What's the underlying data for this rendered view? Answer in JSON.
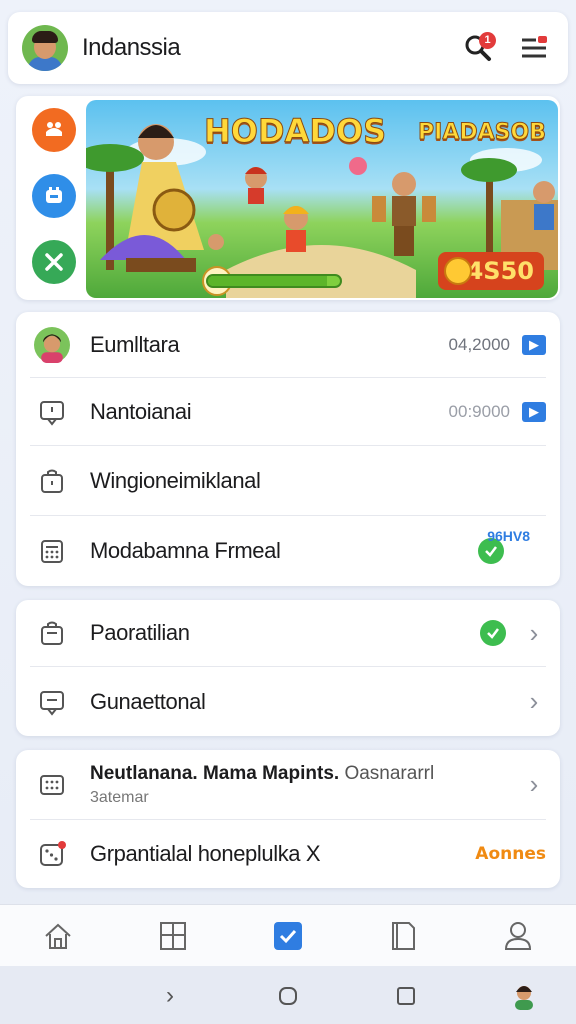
{
  "header": {
    "title": "Indanssia",
    "notification_count": "1"
  },
  "banner": {
    "title_left": "HODADOS",
    "title_right": "PIADASOB",
    "score": "4S50",
    "progress": 0.9
  },
  "list1": {
    "rows": [
      {
        "label": "Eumlltara",
        "value": "04,2000"
      },
      {
        "label": "Nantoianai",
        "value": "00:9000"
      },
      {
        "label": "Wingioneimiklanal"
      },
      {
        "label": "Modabamna Frmeal",
        "tag": "96HV8"
      }
    ]
  },
  "list2": {
    "rows": [
      {
        "label": "Paoratilian"
      },
      {
        "label": "Gunaettonal"
      }
    ]
  },
  "list3": {
    "rows": [
      {
        "label_bold": "Neutlanana. Mama Mapints.",
        "label_rest": " Oasnararrl",
        "sub": "3atemar"
      },
      {
        "label": "Grpantialal honeplulka X",
        "tag": "Aonnes"
      }
    ]
  },
  "colors": {
    "accent": "#2f7de1",
    "success": "#3dbd4f",
    "orange": "#f08a12",
    "badge": "#e23b3b"
  },
  "icons": {
    "header": [
      "avatar",
      "search-icon",
      "menu-settings-icon"
    ],
    "side": [
      "orange-chat-icon",
      "blue-app-icon",
      "green-tools-icon"
    ],
    "nav": [
      "home-icon",
      "grid-icon",
      "check-icon",
      "document-icon",
      "profile-icon"
    ],
    "system": [
      "back-icon",
      "home-circle-icon",
      "recents-icon",
      "avatar-icon"
    ]
  }
}
